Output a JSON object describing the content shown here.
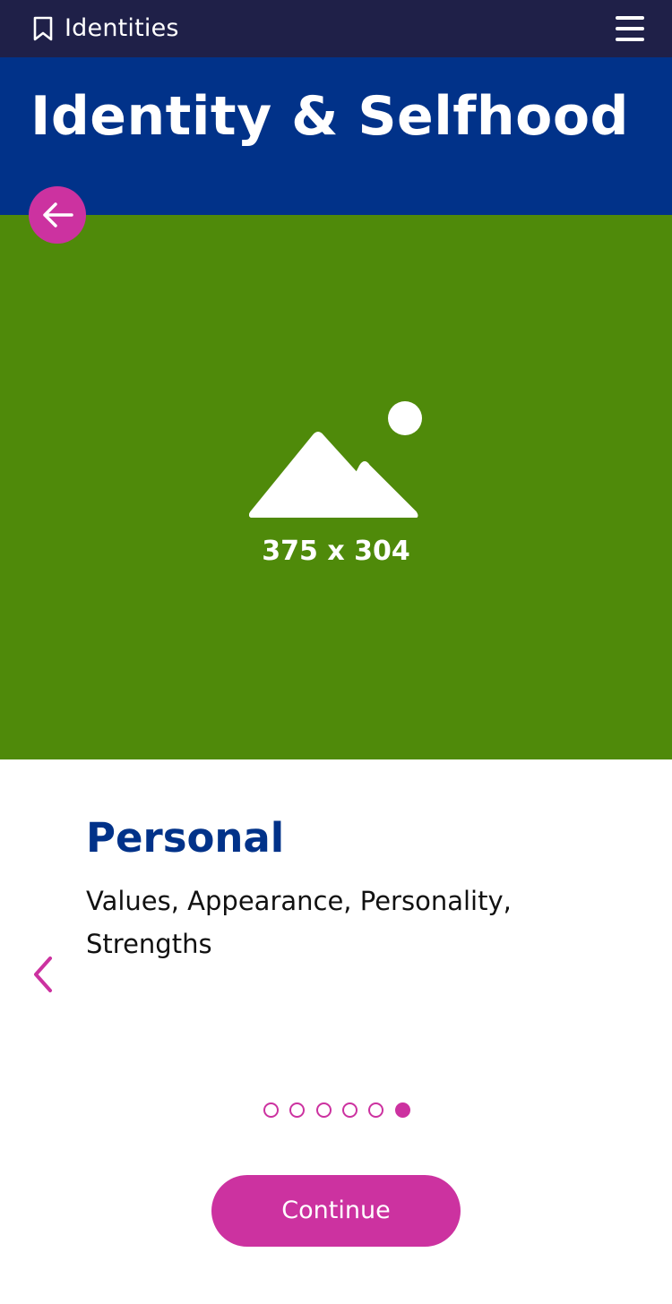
{
  "topbar": {
    "title": "Identities",
    "bookmark_icon": "bookmark-icon",
    "menu_icon": "hamburger-menu-icon",
    "background": "#1f2048"
  },
  "header": {
    "title": "Identity & Selfhood",
    "background": "#013289",
    "back_icon": "arrow-left-icon"
  },
  "hero": {
    "background": "#4f8a0a",
    "placeholder_icon": "image-placeholder-icon",
    "placeholder_label": "375 x 304"
  },
  "card": {
    "title": "Personal",
    "description": "Values, Appearance, Personality, Strengths",
    "prev_icon": "chevron-left-icon"
  },
  "pagination": {
    "total": 6,
    "active_index": 5
  },
  "actions": {
    "continue_label": "Continue"
  },
  "colors": {
    "accent": "#cc32a0",
    "heading": "#013289"
  }
}
